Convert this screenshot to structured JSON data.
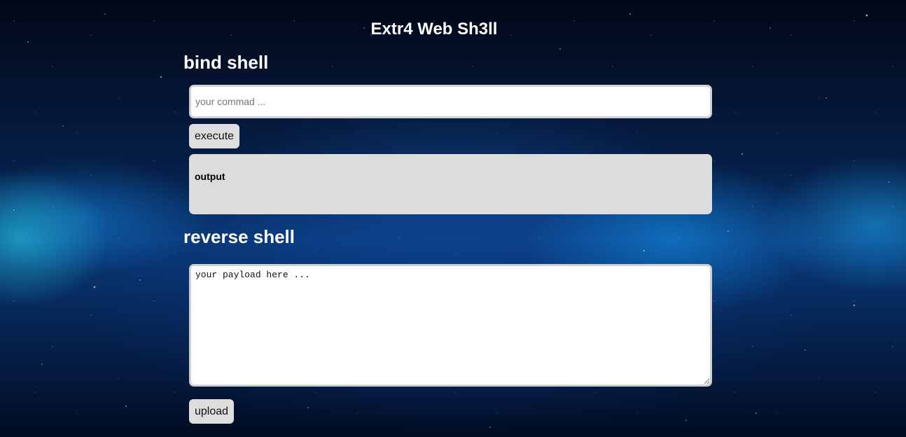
{
  "page": {
    "title": "Extr4 Web Sh3ll"
  },
  "bind_shell": {
    "heading": "bind shell",
    "command_placeholder": "your commad ...",
    "command_value": "",
    "execute_label": "execute",
    "output_label": "output"
  },
  "reverse_shell": {
    "heading": "reverse shell",
    "payload_placeholder": "your payload here ...",
    "payload_value": "",
    "upload_label": "upload"
  }
}
